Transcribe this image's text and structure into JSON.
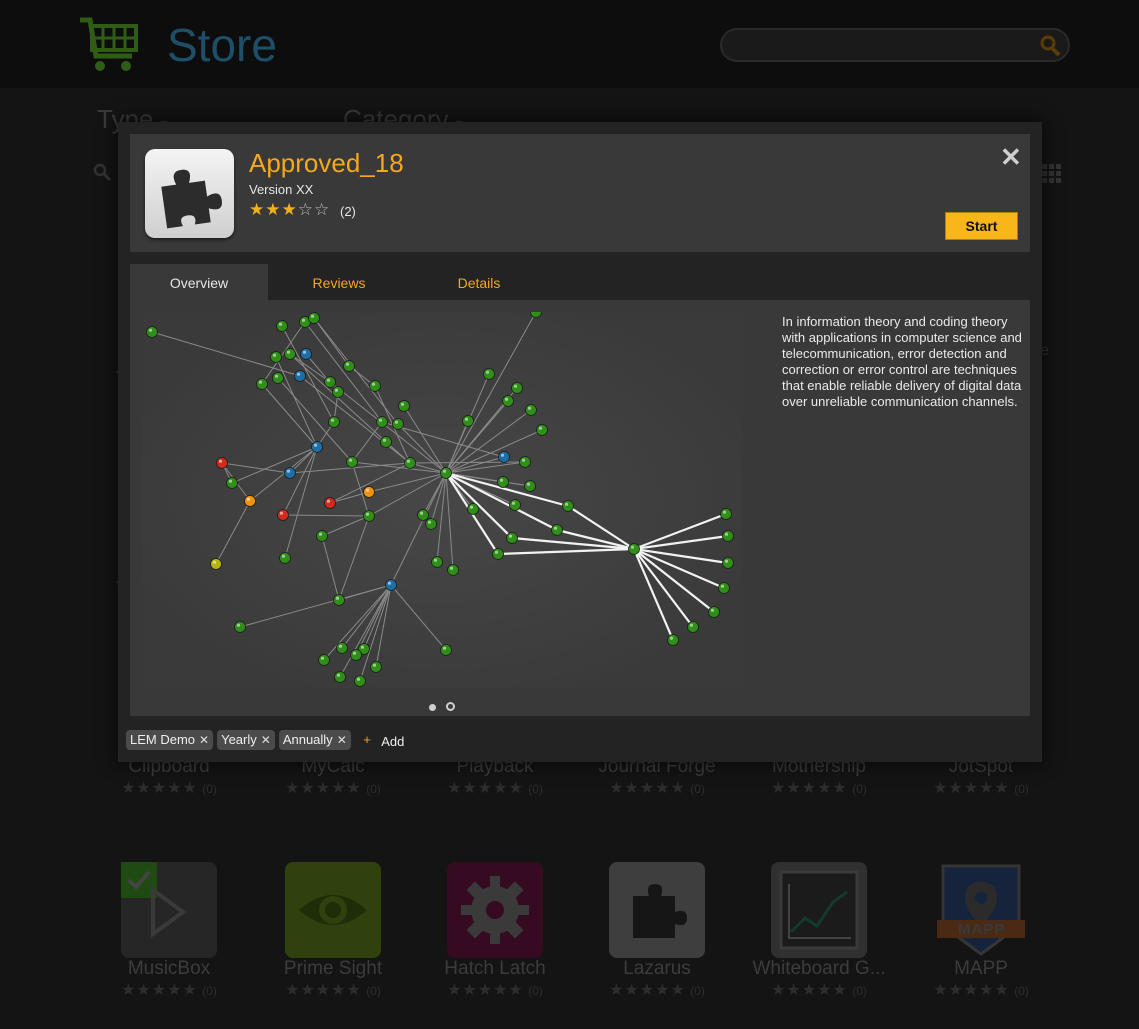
{
  "store": {
    "title": "Store",
    "search": {
      "placeholder": ""
    },
    "filters": {
      "type_label": "Type",
      "category_label": "Category",
      "caret": "▾"
    },
    "edge_text": "e",
    "rows": [
      [
        {
          "name": "Clipboard",
          "rating": "★★★★★",
          "count": "(0)"
        },
        {
          "name": "MyCalc",
          "rating": "★★★★★",
          "count": "(0)"
        },
        {
          "name": "Playback",
          "rating": "★★★★★",
          "count": "(0)"
        },
        {
          "name": "Journal Forge",
          "rating": "★★★★★",
          "count": "(0)"
        },
        {
          "name": "Mothership",
          "rating": "★★★★★",
          "count": "(0)"
        },
        {
          "name": "JotSpot",
          "rating": "★★★★★",
          "count": "(0)"
        }
      ],
      [
        {
          "name": "MusicBox",
          "rating": "★★★★★",
          "count": "(0)",
          "icon": "play-icon",
          "color": "#2a2a2a"
        },
        {
          "name": "Prime Sight",
          "rating": "★★★★★",
          "count": "(0)",
          "icon": "eye-icon",
          "color": "#3f5a12"
        },
        {
          "name": "Hatch Latch",
          "rating": "★★★★★",
          "count": "(0)",
          "icon": "gear-icon",
          "color": "#4a0d2c"
        },
        {
          "name": "Lazarus",
          "rating": "★★★★★",
          "count": "(0)",
          "icon": "puzzle-icon",
          "color": "#4a4a4a"
        },
        {
          "name": "Whiteboard G...",
          "rating": "★★★★★",
          "count": "(0)",
          "icon": "chart-line-icon",
          "color": "#404040"
        },
        {
          "name": "MAPP",
          "rating": "★★★★★",
          "count": "(0)",
          "icon": "map-pin-icon",
          "color": "#1c3050",
          "badge": "MAPP"
        }
      ]
    ]
  },
  "modal": {
    "title": "Approved_18",
    "version": "Version XX",
    "stars_filled": "★★★",
    "stars_empty": "☆☆",
    "rating": 3,
    "rating_count": "(2)",
    "close_symbol": "✕",
    "start_label": "Start",
    "tabs": [
      {
        "label": "Overview"
      },
      {
        "label": "Reviews"
      },
      {
        "label": "Details"
      }
    ],
    "description": "In information theory and coding theory with applications in computer science and telecommunication, error detection and correction or error control are techniques that enable reliable delivery of digital data over unreliable communication channels.",
    "carousel": {
      "current": 1,
      "total": 2
    },
    "tags": [
      {
        "label": "LEM Demo"
      },
      {
        "label": "Yearly"
      },
      {
        "label": "Annually"
      }
    ],
    "tag_remove_symbol": "✕",
    "add_symbol": "+",
    "add_label": "Add"
  },
  "colors": {
    "accent": "#f4a81d",
    "start_button": "#f8b61a",
    "node_green": "#2f8f18",
    "node_blue": "#1e6fa6",
    "node_red": "#d12b1b",
    "node_orange": "#f0930f",
    "node_yellow": "#b7b410"
  }
}
